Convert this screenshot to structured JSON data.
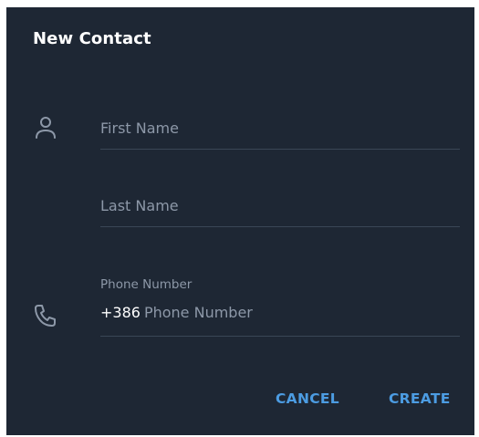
{
  "dialog": {
    "title": "New Contact"
  },
  "fields": {
    "first_name_placeholder": "First Name",
    "last_name_placeholder": "Last Name",
    "phone_label": "Phone Number",
    "phone_country_code": "+386",
    "phone_placeholder": "Phone Number"
  },
  "buttons": {
    "cancel": "CANCEL",
    "create": "CREATE"
  },
  "icons": {
    "name_field": "person-icon",
    "phone_field": "phone-icon"
  },
  "colors": {
    "background": "#1e2734",
    "accent": "#4c9ce2",
    "muted_text": "#8d98a8",
    "divider": "#3a4656"
  }
}
